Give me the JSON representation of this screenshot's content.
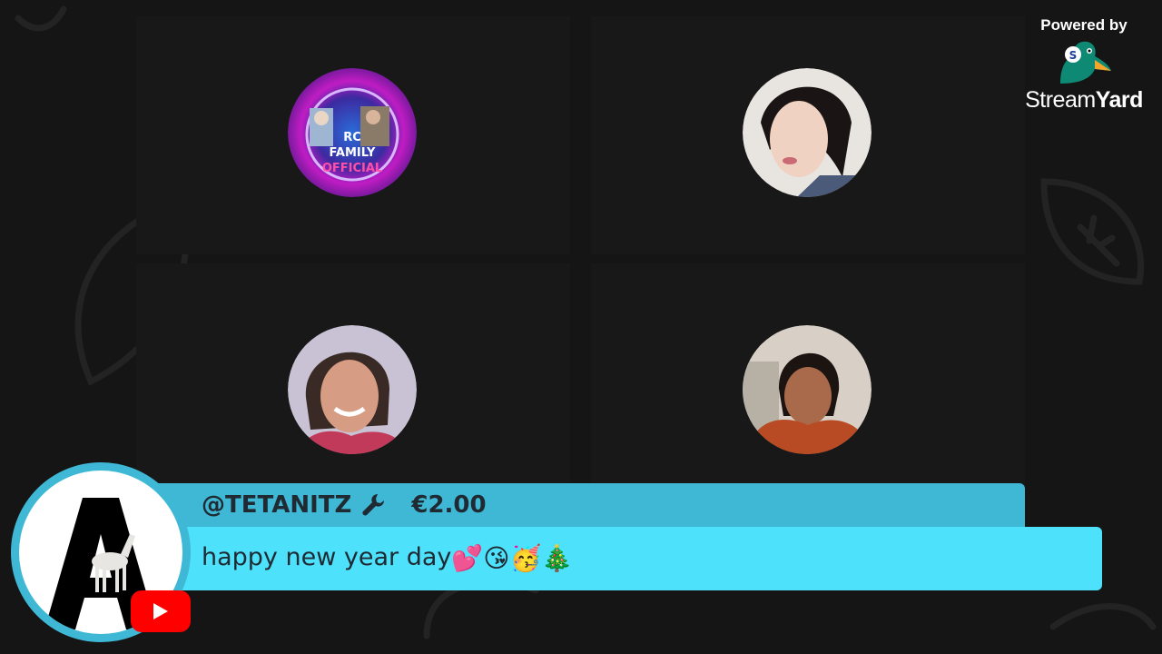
{
  "participants": [
    {
      "name": "participant-rc-family",
      "avatar_text": [
        "RC",
        "FAMILY",
        "OFFICIAL"
      ]
    },
    {
      "name": "participant-2"
    },
    {
      "name": "participant-3"
    },
    {
      "name": "participant-4"
    }
  ],
  "branding": {
    "powered_by": "Powered by",
    "brand_name_regular": "Stream",
    "brand_name_bold": "Yard"
  },
  "comment": {
    "author": "@TETANITZ",
    "author_icon": "wrench-icon",
    "amount": "€2.00",
    "message": "happy new year day",
    "emojis": [
      "💕",
      "😘",
      "🥳",
      "🎄"
    ],
    "platform_icon": "youtube-icon",
    "colors": {
      "header": "#3fb8d6",
      "body": "#4ee1fb",
      "text": "#1f2a33"
    }
  }
}
